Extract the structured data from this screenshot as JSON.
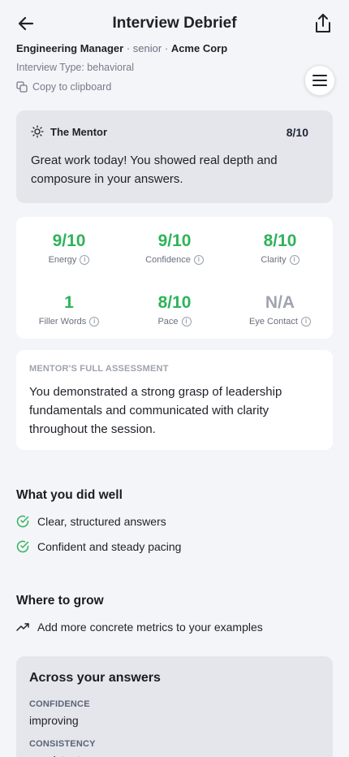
{
  "header": {
    "title": "Interview Debrief"
  },
  "meta": {
    "role": "Engineering Manager",
    "sep1": "·",
    "level": "senior",
    "sep2": "·",
    "company": "Acme Corp",
    "interview_type": "Interview Type: behavioral",
    "copy_label": "Copy to clipboard"
  },
  "mentor": {
    "name": "The Mentor",
    "score": "8/10",
    "message": "Great work today! You showed real depth and composure in your answers."
  },
  "stats": [
    {
      "value": "9/10",
      "label": "Energy"
    },
    {
      "value": "9/10",
      "label": "Confidence"
    },
    {
      "value": "8/10",
      "label": "Clarity"
    },
    {
      "value": "1",
      "label": "Filler Words"
    },
    {
      "value": "8/10",
      "label": "Pace"
    },
    {
      "value": "N/A",
      "label": "Eye Contact"
    }
  ],
  "assessment": {
    "title": "MENTOR'S FULL ASSESSMENT",
    "text": "You demonstrated a strong grasp of leadership fundamentals and communicated with clarity throughout the session."
  },
  "did_well": {
    "title": "What you did well",
    "items": [
      "Clear, structured answers",
      "Confident and steady pacing"
    ]
  },
  "grow": {
    "title": "Where to grow",
    "items": [
      "Add more concrete metrics to your examples"
    ]
  },
  "across": {
    "title": "Across your answers",
    "traits": [
      {
        "label": "CONFIDENCE",
        "value": "improving"
      },
      {
        "label": "CONSISTENCY",
        "value": "consistent"
      }
    ]
  },
  "colors": {
    "accent_green": "#2fb35b",
    "background": "#f4f5f8",
    "card_gray": "#e4e6ec"
  },
  "icons": [
    "arrow-left-icon",
    "share-icon",
    "copy-icon",
    "hamburger-menu-icon",
    "sun-icon",
    "info-icon",
    "check-circle-icon",
    "trending-up-icon"
  ]
}
